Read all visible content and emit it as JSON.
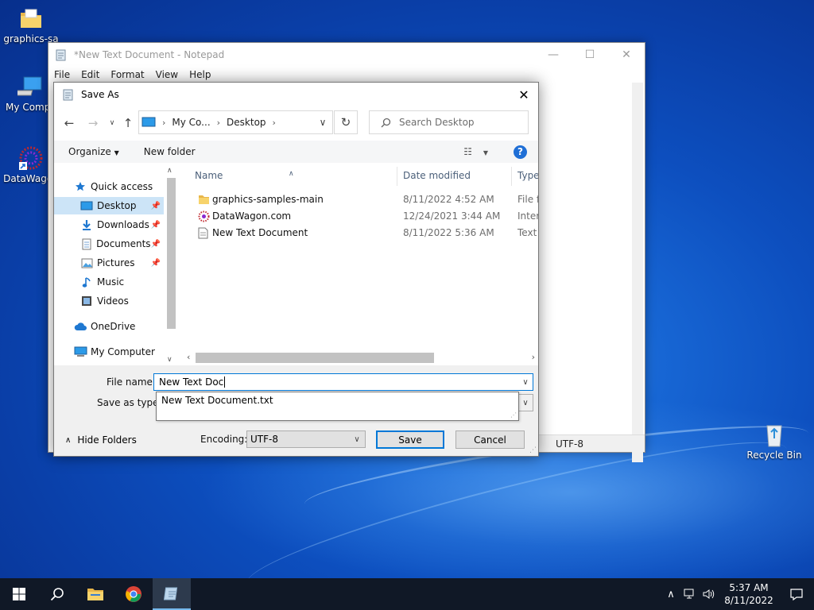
{
  "desktop": {
    "icons": [
      {
        "label": "graphics-sa",
        "icon": "folder-icon"
      },
      {
        "label": "My Compu",
        "icon": "computer-icon"
      },
      {
        "label": "DataWagon",
        "icon": "datawagon-icon"
      },
      {
        "label": "Recycle Bin",
        "icon": "recycle-bin-icon"
      }
    ]
  },
  "notepad": {
    "title": "*New Text Document - Notepad",
    "menu": [
      "File",
      "Edit",
      "Format",
      "View",
      "Help"
    ],
    "status_encoding": "UTF-8"
  },
  "dialog": {
    "title": "Save As",
    "breadcrumb": [
      "My Co...",
      "Desktop"
    ],
    "search_placeholder": "Search Desktop",
    "toolbar": {
      "organize": "Organize",
      "new_folder": "New folder",
      "help": "?"
    },
    "nav": [
      {
        "label": "Quick access",
        "icon": "star-icon"
      },
      {
        "label": "Desktop",
        "icon": "desktop-icon",
        "pinned": true,
        "selected": true
      },
      {
        "label": "Downloads",
        "icon": "download-icon",
        "pinned": true
      },
      {
        "label": "Documents",
        "icon": "document-icon",
        "pinned": true
      },
      {
        "label": "Pictures",
        "icon": "pictures-icon",
        "pinned": true
      },
      {
        "label": "Music",
        "icon": "music-icon"
      },
      {
        "label": "Videos",
        "icon": "video-icon"
      },
      {
        "label": "OneDrive",
        "icon": "cloud-icon"
      },
      {
        "label": "My Computer",
        "icon": "computer-icon"
      }
    ],
    "columns": {
      "name": "Name",
      "date": "Date modified",
      "type": "Type"
    },
    "files": [
      {
        "name": "graphics-samples-main",
        "date": "8/11/2022 4:52 AM",
        "type": "File fo",
        "icon": "folder-icon"
      },
      {
        "name": "DataWagon.com",
        "date": "12/24/2021 3:44 AM",
        "type": "Intern",
        "icon": "internet-shortcut-icon"
      },
      {
        "name": "New Text Document",
        "date": "8/11/2022 5:36 AM",
        "type": "Text D",
        "icon": "text-file-icon"
      }
    ],
    "file_name_label": "File name:",
    "file_name_value": "New Text Doc",
    "save_as_type_label": "Save as type:",
    "autocomplete": "New Text Document.txt",
    "hide_folders": "Hide Folders",
    "encoding_label": "Encoding:",
    "encoding_value": "UTF-8",
    "save": "Save",
    "cancel": "Cancel"
  },
  "taskbar": {
    "time": "5:37 AM",
    "date": "8/11/2022"
  }
}
